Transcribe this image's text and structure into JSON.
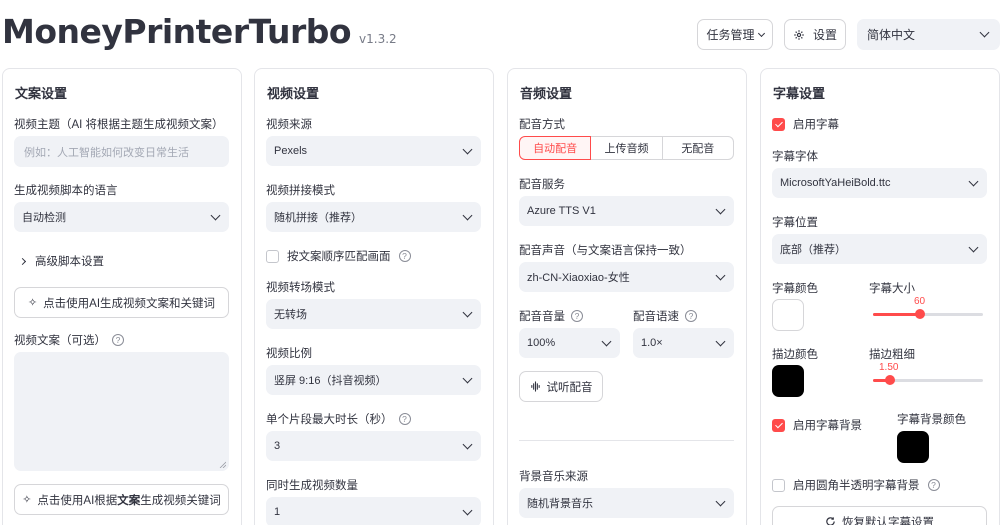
{
  "header": {
    "title": "MoneyPrinterTurbo",
    "version": "v1.3.2",
    "task_button": "任务管理",
    "settings_button": "设置",
    "language": "简体中文"
  },
  "script_card": {
    "title": "文案设置",
    "topic_label": "视频主题（AI 将根据主题生成视频文案）",
    "topic_placeholder": "例如：人工智能如何改变日常生活",
    "language_label": "生成视频脚本的语言",
    "language_value": "自动检测",
    "advanced_label": "高级脚本设置",
    "generate_script_button": "点击使用AI生成视频文案和关键词",
    "script_label": "视频文案（可选）",
    "gen_keywords_prefix": "点击使用AI根据",
    "gen_keywords_bold": "文案",
    "gen_keywords_suffix": "生成视频关键词"
  },
  "video_card": {
    "title": "视频设置",
    "source_label": "视频来源",
    "source_value": "Pexels",
    "concat_label": "视频拼接模式",
    "concat_value": "随机拼接（推荐）",
    "match_order_label": "按文案顺序匹配画面",
    "match_order_checked": false,
    "transition_label": "视频转场模式",
    "transition_value": "无转场",
    "ratio_label": "视频比例",
    "ratio_value": "竖屏 9:16（抖音视频）",
    "max_clip_label": "单个片段最大时长（秒）",
    "max_clip_value": "3",
    "count_label": "同时生成视频数量",
    "count_value": "1"
  },
  "audio_card": {
    "title": "音频设置",
    "dubbing_label": "配音方式",
    "dubbing_options": [
      "自动配音",
      "上传音频",
      "无配音"
    ],
    "dubbing_selected": "自动配音",
    "service_label": "配音服务",
    "service_value": "Azure TTS V1",
    "voice_label": "配音声音（与文案语言保持一致）",
    "voice_value": "zh-CN-Xiaoxiao-女性",
    "volume_label": "配音音量",
    "volume_value": "100%",
    "speed_label": "配音语速",
    "speed_value": "1.0×",
    "preview_button": "试听配音",
    "bgm_label": "背景音乐来源",
    "bgm_value": "随机背景音乐"
  },
  "subtitle_card": {
    "title": "字幕设置",
    "enable_label": "启用字幕",
    "enable_checked": true,
    "font_label": "字幕字体",
    "font_value": "MicrosoftYaHeiBold.ttc",
    "position_label": "字幕位置",
    "position_value": "底部（推荐）",
    "color_label": "字幕颜色",
    "color_value": "#ffffff",
    "size_label": "字幕大小",
    "size_value": "60",
    "size_fraction": 0.43,
    "stroke_color_label": "描边颜色",
    "stroke_color_value": "#000000",
    "stroke_width_label": "描边粗细",
    "stroke_width_value": "1.50",
    "stroke_width_fraction": 0.15,
    "bg_enable_label": "启用字幕背景",
    "bg_enable_checked": true,
    "bg_color_label": "字幕背景颜色",
    "bg_color_value": "#000000",
    "rounded_bg_label": "启用圆角半透明字幕背景",
    "rounded_bg_checked": false,
    "reset_button": "恢复默认字幕设置"
  },
  "colors": {
    "accent": "#ff4b4b",
    "input_bg": "#f0f2f6",
    "border": "#e4e5e9"
  }
}
